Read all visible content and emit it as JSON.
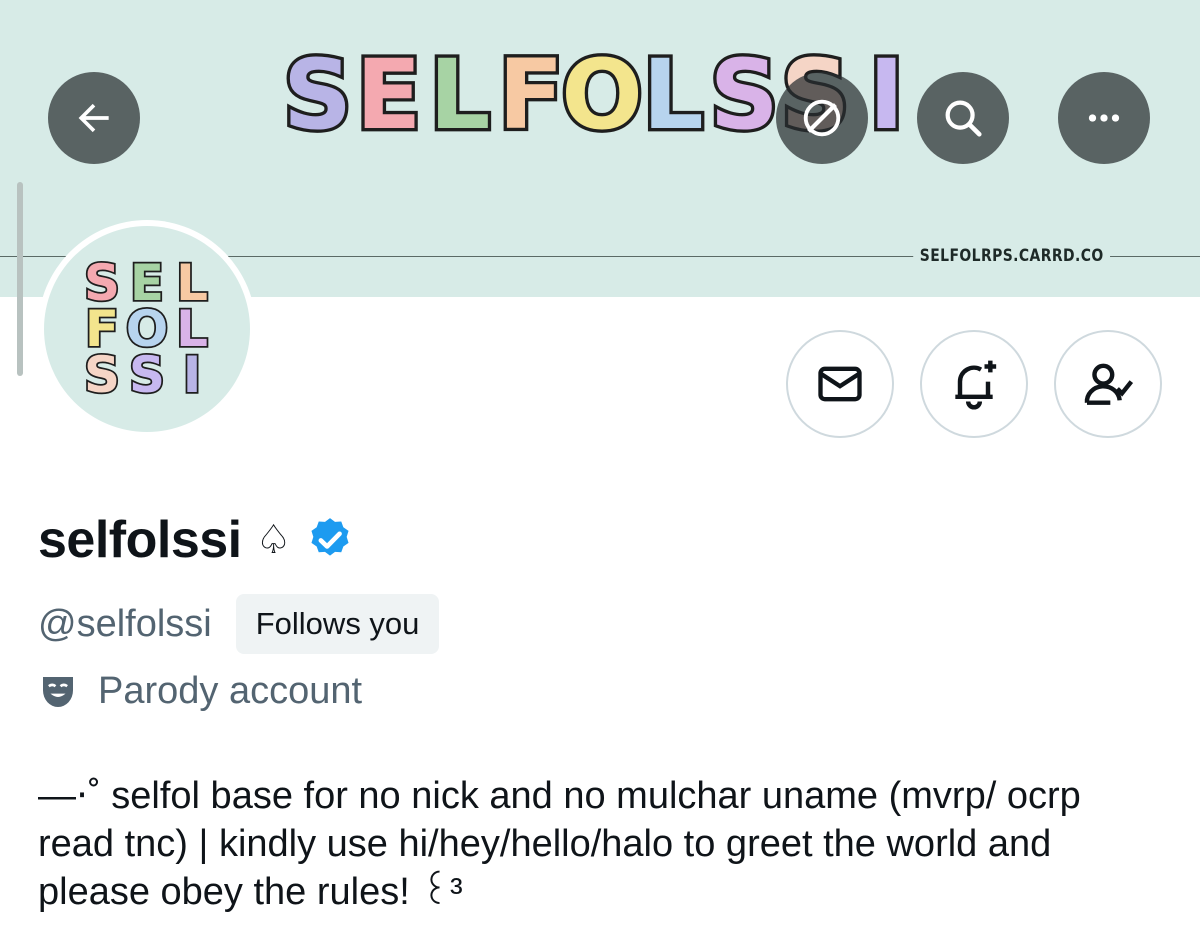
{
  "banner": {
    "logo_text": "SELFOLSSI",
    "url_text": "SELFOLRPS.CARRD.CO",
    "colors": [
      "#b8b4e6",
      "#f4a9b0",
      "#a7d3a4",
      "#f7c9a3",
      "#f3e58d",
      "#b7d4ee",
      "#d9b3e8",
      "#f5d5c6",
      "#c7b8f0"
    ]
  },
  "nav": {
    "back_icon": "arrow-left-icon",
    "hide_icon": "eye-slash-icon",
    "search_icon": "search-icon",
    "more_icon": "more-horizontal-icon"
  },
  "avatar": {
    "lines": [
      "SEL",
      "FOL",
      "SSI"
    ]
  },
  "actions": {
    "message_icon": "mail-icon",
    "notify_icon": "bell-plus-icon",
    "following_icon": "person-check-icon"
  },
  "profile": {
    "display_name": "selfolssi",
    "name_emoji": "♤",
    "handle": "@selfolssi",
    "follows_you": "Follows you",
    "parody_label": "Parody account",
    "bio": "—⋅˚ selfol base for no nick and no mulchar uname (mvrp/ ocrp read tnc) | kindly use hi/hey/hello/halo to greet the world and please obey the rules! ꒰³"
  },
  "theme": {
    "banner_bg": "#d7ebe7",
    "verified_blue": "#1d9bf0",
    "secondary_text": "#536471"
  }
}
